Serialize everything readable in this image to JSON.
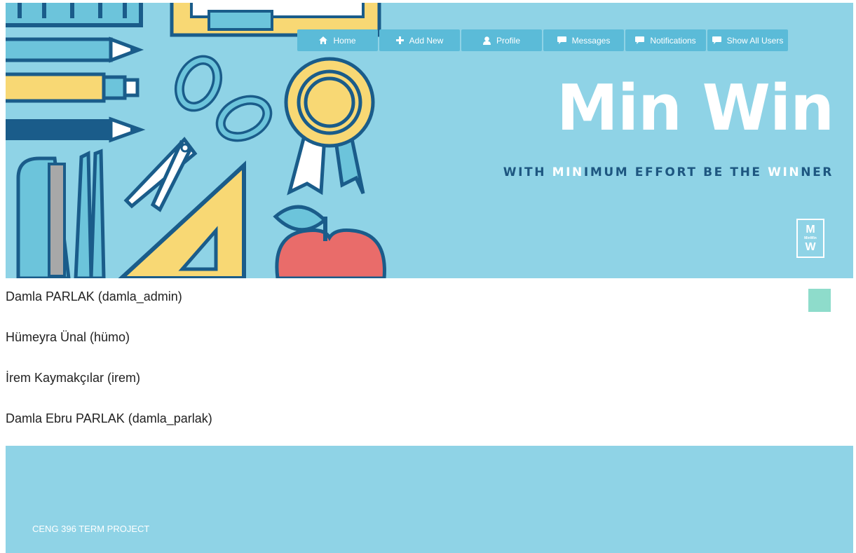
{
  "nav": {
    "items": [
      {
        "label": "Home",
        "icon": "home-icon"
      },
      {
        "label": "Add New",
        "icon": "plus-icon"
      },
      {
        "label": "Profile",
        "icon": "user-icon"
      },
      {
        "label": "Messages",
        "icon": "chat-icon"
      },
      {
        "label": "Notifications",
        "icon": "chat-icon"
      },
      {
        "label": "Show All Users",
        "icon": "chat-icon"
      }
    ]
  },
  "brand": {
    "title": "Min Win",
    "tagline": {
      "p1": "WITH ",
      "h1": "MIN",
      "p2": "IMUM EFFORT BE THE ",
      "h2": "WIN",
      "p3": "NER"
    },
    "badge": {
      "top": "M",
      "middle": "MinWin",
      "bottom": "W"
    }
  },
  "users": [
    "Damla PARLAK (damla_admin)",
    "Hümeyra Ünal (hümo)",
    "İrem Kaymakçılar (irem)",
    "Damla Ebru PARLAK (damla_parlak)"
  ],
  "footer": {
    "text": "CENG 396 TERM PROJECT"
  },
  "colors": {
    "header_bg": "#8fd3e6",
    "nav_bg": "#5bbbd8",
    "tagline": "#1d5680",
    "status_square": "#8edccb"
  }
}
